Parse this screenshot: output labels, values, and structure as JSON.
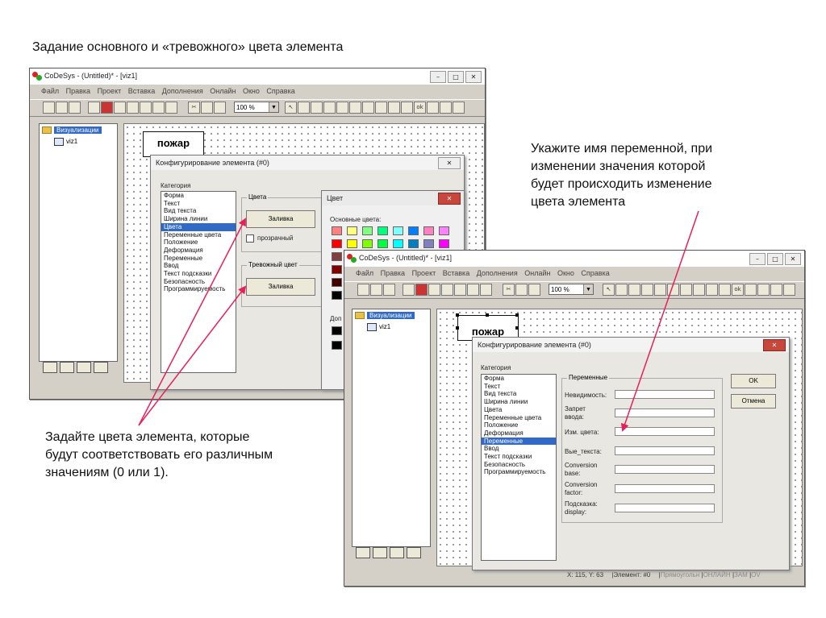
{
  "slide": {
    "title": "Задание основного и «тревожного» цвета элемента",
    "annotation_right": [
      "Укажите имя переменной, при",
      "изменении значения которой",
      "будет происходить изменение",
      "цвета элемента"
    ],
    "annotation_left": [
      "Задайте цвета элемента, которые",
      "будут соответствовать его различным",
      "значениям (0 или 1)."
    ]
  },
  "app": {
    "title": "CoDeSys - (Untitled)* - [viz1]",
    "menu": [
      "Файл",
      "Правка",
      "Проект",
      "Вставка",
      "Дополнения",
      "Онлайн",
      "Окно",
      "Справка"
    ],
    "zoom": "100 %",
    "tree_root": "Визуализации",
    "tree_child": "viz1",
    "element_text": "пожар",
    "status_coords": "X:   115, Y:    63",
    "status_element": "Элемент: #0",
    "status_mode": "Прямоугольн",
    "status_online": "ОНЛАЙН",
    "status_zoom": "ЗАМ",
    "status_ov": "ОV"
  },
  "dialog_colors": {
    "title": "Конфигурирование элемента (#0)",
    "category_label": "Категория",
    "categories": [
      "Форма",
      "Текст",
      "Вид текста",
      "Ширина линии",
      "Цвета",
      "Переменные цвета",
      "Положение",
      "Деформация",
      "Переменные",
      "Ввод",
      "Текст подсказки",
      "Безопасность",
      "Программируемость"
    ],
    "selected_index": 4,
    "group_colors": "Цвета",
    "fill_button": "Заливка",
    "transparent_label": "прозрачный",
    "group_alarm": "Тревожный цвет",
    "alarm_fill_button": "Заливка"
  },
  "color_picker": {
    "title": "Цвет",
    "basic_label": "Основные цвета:",
    "custom_label_partial": "Доп",
    "swatches": [
      [
        "#ff8080",
        "#ffff80",
        "#80ff80",
        "#00ff80",
        "#80ffff",
        "#0080ff",
        "#ff80c0",
        "#ff80ff"
      ],
      [
        "#ff0000",
        "#ffff00",
        "#80ff00",
        "#00ff40",
        "#00ffff",
        "#0080c0",
        "#8080c0",
        "#ff00ff"
      ],
      [
        "#804040",
        "#ff8040",
        "#00ff00",
        "#008080",
        "#004080",
        "#8080ff",
        "#800040",
        "#ff0080"
      ],
      [
        "#800000",
        "#ff8000",
        "#008000",
        "#008040",
        "#0000ff",
        "#0000a0",
        "#800080",
        "#8000ff"
      ],
      [
        "#400000",
        "#804000",
        "#004000",
        "#004040",
        "#000080",
        "#000040",
        "#400040",
        "#400080"
      ],
      [
        "#000000",
        "#808000",
        "#808040",
        "#808080",
        "#408080",
        "#c0c0c0",
        "#400040",
        "#ffffff"
      ]
    ]
  },
  "dialog_vars": {
    "title": "Конфигурирование элемента (#0)",
    "category_label": "Категория",
    "categories": [
      "Форма",
      "Текст",
      "Вид текста",
      "Ширина линии",
      "Цвета",
      "Переменные цвета",
      "Положение",
      "Деформация",
      "Переменные",
      "Ввод",
      "Текст подсказки",
      "Безопасность",
      "Программируемость"
    ],
    "selected_index": 8,
    "group_label": "Переменные",
    "fields": [
      {
        "label": "Невидимость:"
      },
      {
        "label": "Запрет ввода:"
      },
      {
        "label": "Изм. цвета:"
      },
      {
        "label": "Вые_текста:"
      },
      {
        "label": "Conversion base:"
      },
      {
        "label": "Conversion factor:"
      },
      {
        "label": "Подсказка: display:"
      }
    ],
    "ok_button": "OK",
    "cancel_button": "Отмена"
  }
}
